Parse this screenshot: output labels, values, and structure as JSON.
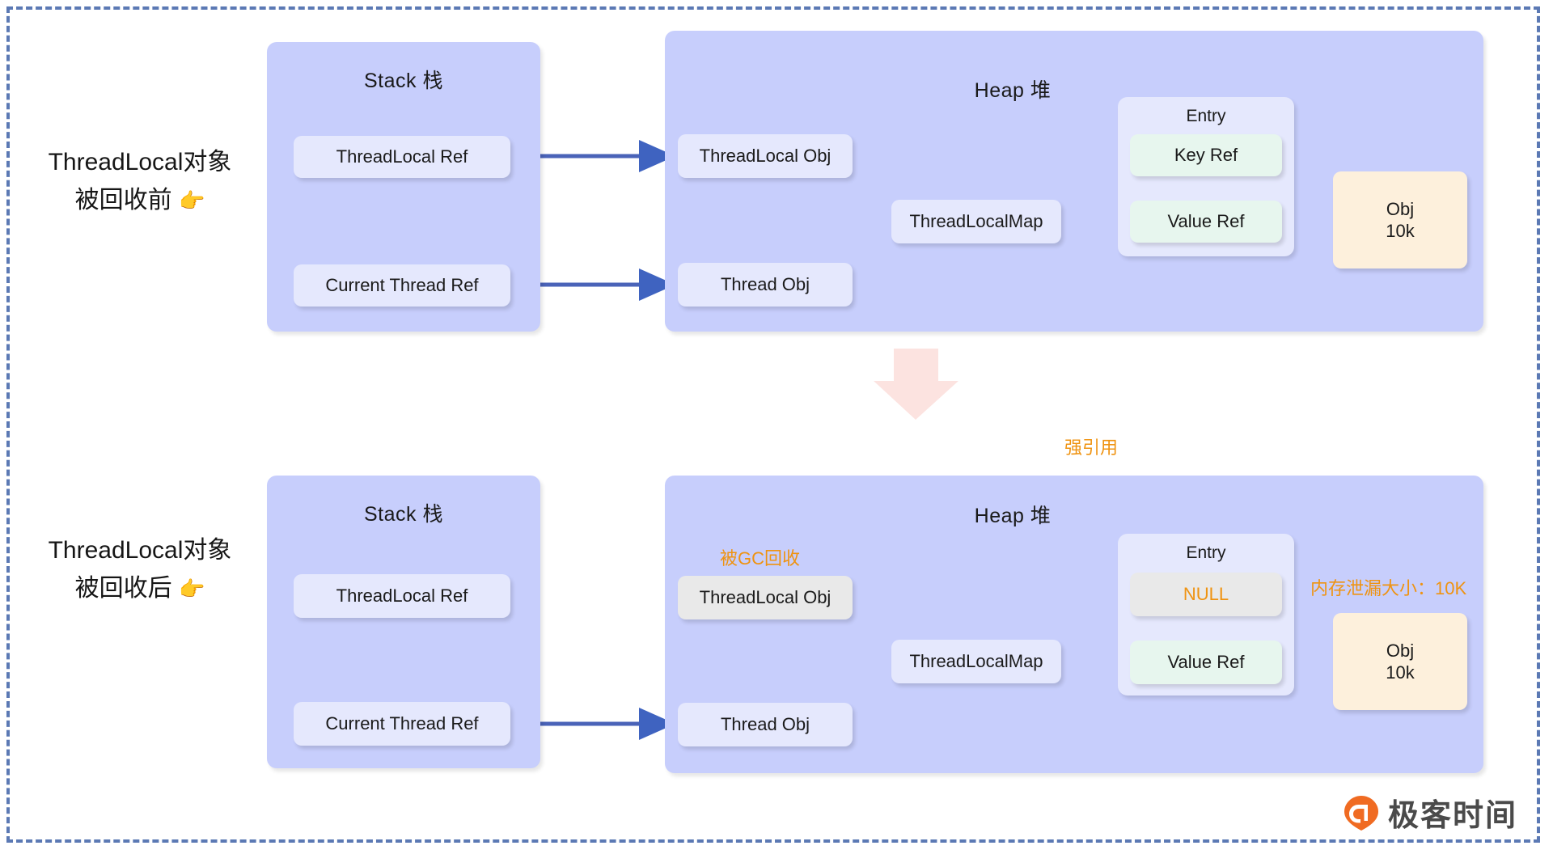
{
  "colors": {
    "frame_border": "#5b79b4",
    "panel_bg": "#c7cefc",
    "node_lavender": "#e5e8fd",
    "node_mint": "#e7f6ee",
    "node_cream": "#fdf0dc",
    "node_gray": "#e9e9e9",
    "arrow_blue": "#3f63c0",
    "weak_ref_red": "#ea6a55",
    "annotation_orange": "#ef9311",
    "big_arrow_pink": "#fce3e0",
    "brand_orange": "#f06b22"
  },
  "sections": [
    {
      "id": "before",
      "side_label_line1": "ThreadLocal对象",
      "side_label_line2": "被回收前",
      "side_label_hand": "👉",
      "stack": {
        "title": "Stack 栈",
        "nodes": [
          {
            "label": "ThreadLocal Ref"
          },
          {
            "label": "Current Thread Ref"
          }
        ]
      },
      "heap": {
        "title": "Heap 堆",
        "nodes": [
          {
            "label": "ThreadLocal Obj"
          },
          {
            "label": "Thread Obj"
          },
          {
            "label": "ThreadLocalMap"
          }
        ],
        "entry": {
          "title": "Entry",
          "key_label": "Key Ref",
          "value_label": "Value Ref"
        },
        "object": {
          "line1": "Obj",
          "line2": "10k"
        }
      }
    },
    {
      "id": "after",
      "side_label_line1": "ThreadLocal对象",
      "side_label_line2": "被回收后",
      "side_label_hand": "👉",
      "stack": {
        "title": "Stack 栈",
        "nodes": [
          {
            "label": "ThreadLocal Ref"
          },
          {
            "label": "Current Thread Ref"
          }
        ]
      },
      "heap": {
        "title": "Heap 堆",
        "gc_annotation": "被GC回收",
        "leak_annotation": "内存泄漏大小：10K",
        "nodes": [
          {
            "label": "ThreadLocal Obj"
          },
          {
            "label": "Thread Obj"
          },
          {
            "label": "ThreadLocalMap"
          }
        ],
        "entry": {
          "title": "Entry",
          "key_label": "NULL",
          "value_label": "Value Ref"
        },
        "object": {
          "line1": "Obj",
          "line2": "10k"
        }
      }
    }
  ],
  "middle": {
    "strong_ref_label": "强引用",
    "transition_arrow": "down-arrow"
  },
  "brand": {
    "name": "极客时间",
    "mark": "geektime-logo"
  }
}
